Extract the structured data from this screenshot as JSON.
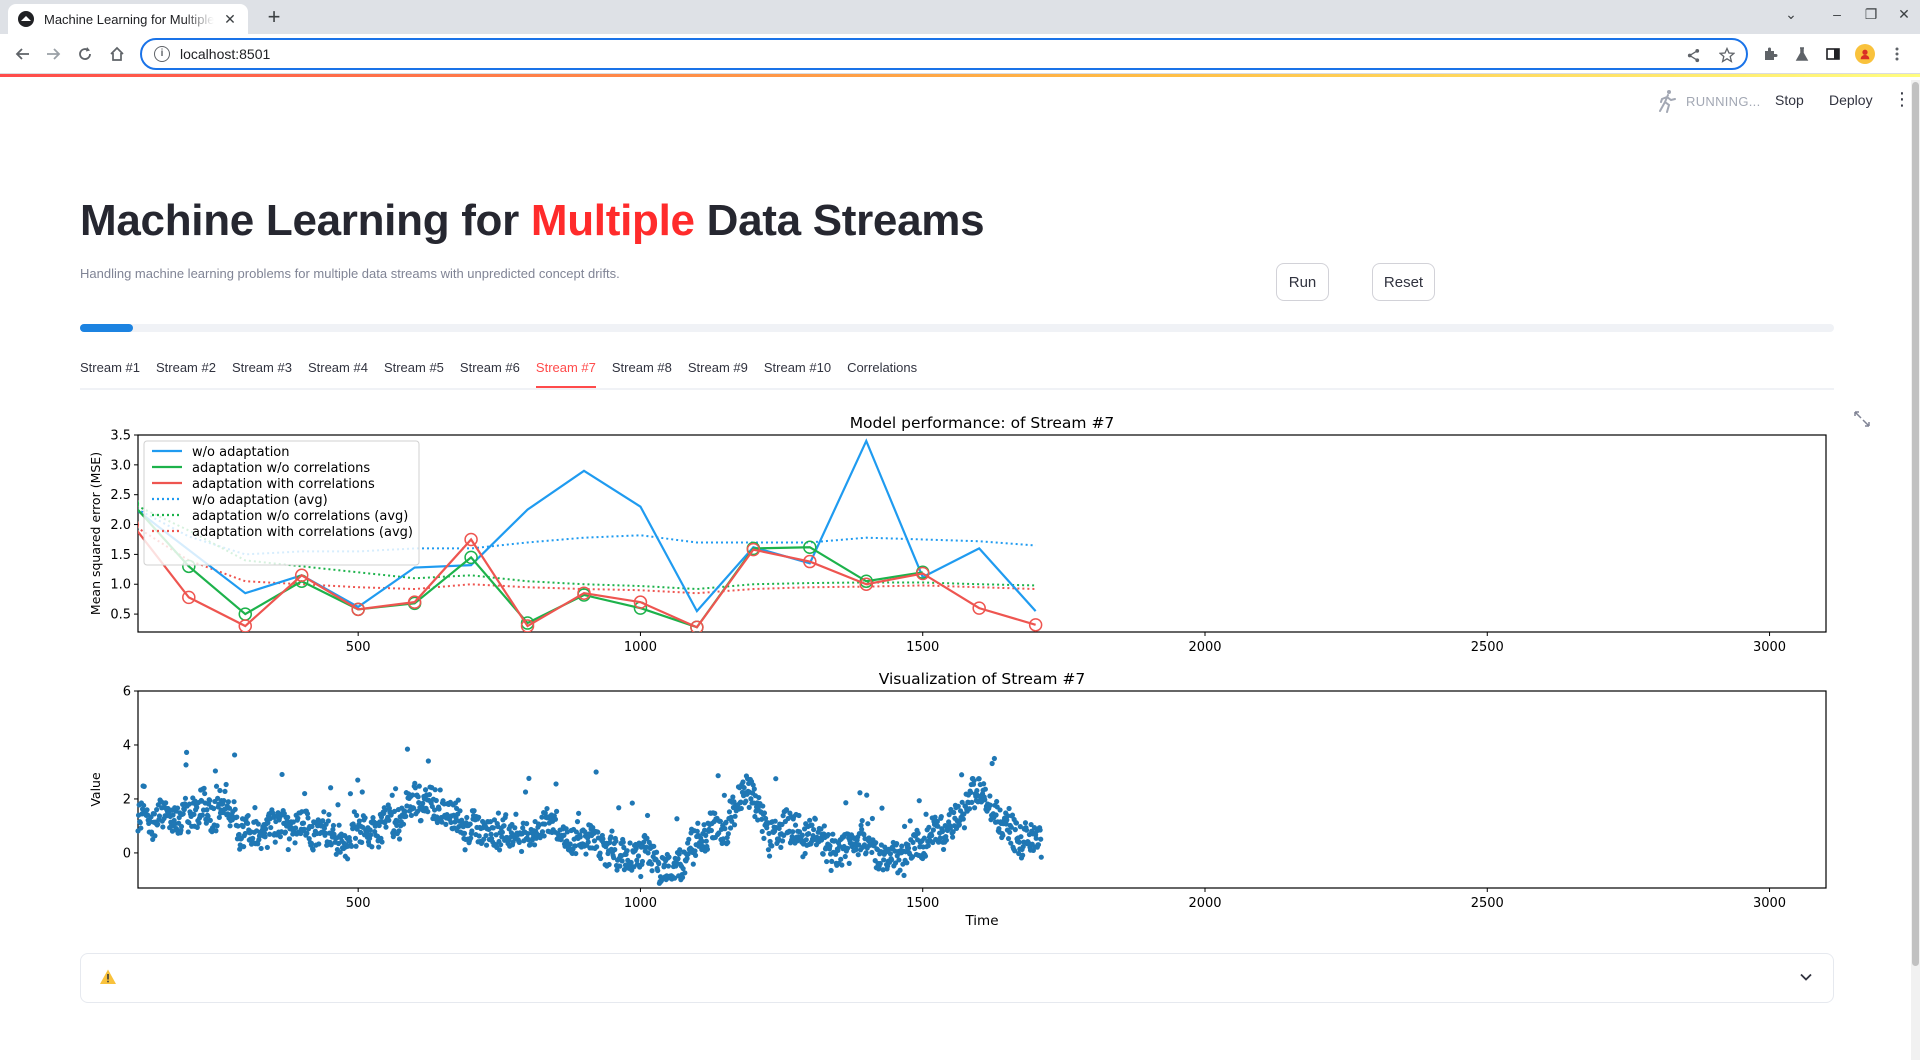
{
  "browser": {
    "tab_title": "Machine Learning for Multiple Data Streams",
    "url": "localhost:8501"
  },
  "header": {
    "status": "RUNNING...",
    "stop_label": "Stop",
    "deploy_label": "Deploy"
  },
  "page": {
    "title_part1": "Machine Learning for ",
    "title_accent": "Multiple",
    "title_part2": " Data Streams",
    "subtitle": "Handling machine learning problems for multiple data streams with unpredicted concept drifts.",
    "run_label": "Run",
    "reset_label": "Reset",
    "progress": 0.03,
    "accent_color": "#ff2b2b"
  },
  "tabs": [
    "Stream #1",
    "Stream #2",
    "Stream #3",
    "Stream #4",
    "Stream #5",
    "Stream #6",
    "Stream #7",
    "Stream #8",
    "Stream #9",
    "Stream #10",
    "Correlations"
  ],
  "active_tab": 6,
  "expander": {
    "icon": "warning-icon",
    "chevron": "chevron-down-icon"
  },
  "chart_data": [
    {
      "type": "line",
      "title": "Model performance: of Stream #7",
      "ylabel": "Mean squared error (MSE)",
      "xlabel": "",
      "xlim": [
        110,
        3100
      ],
      "ylim": [
        0.2,
        3.5
      ],
      "xticks": [
        500,
        1000,
        1500,
        2000,
        2500,
        3000
      ],
      "yticks": [
        0.5,
        1.0,
        1.5,
        2.0,
        2.5,
        3.0,
        3.5
      ],
      "ytick_labels": [
        "0.5",
        "1.0",
        "1.5",
        "2.0",
        "2.5",
        "3.0",
        "3.5"
      ],
      "legend_position": "upper-left",
      "series": [
        {
          "name": "w/o adaptation",
          "color": "#1f9bf0",
          "style": "solid",
          "markers": false,
          "x": [
            100,
            300,
            400,
            500,
            600,
            700,
            800,
            900,
            1000,
            1100,
            1200,
            1300,
            1400,
            1500,
            1600,
            1700
          ],
          "y": [
            2.3,
            0.85,
            1.15,
            0.62,
            1.28,
            1.32,
            2.25,
            2.9,
            2.3,
            0.55,
            1.62,
            1.35,
            3.4,
            1.12,
            1.6,
            0.55
          ]
        },
        {
          "name": "adaptation w/o correlations",
          "color": "#1db24b",
          "style": "solid",
          "markers": true,
          "x": [
            100,
            200,
            300,
            400,
            500,
            600,
            700,
            800,
            900,
            1000,
            1100,
            1200,
            1300,
            1400,
            1500
          ],
          "y": [
            2.35,
            1.3,
            0.5,
            1.05,
            0.58,
            0.68,
            1.45,
            0.35,
            0.82,
            0.6,
            0.28,
            1.6,
            1.62,
            1.05,
            1.2
          ]
        },
        {
          "name": "adaptation with correlations",
          "color": "#ee5550",
          "style": "solid",
          "markers": true,
          "x": [
            100,
            200,
            300,
            400,
            500,
            600,
            700,
            800,
            900,
            1000,
            1100,
            1200,
            1300,
            1400,
            1500,
            1600,
            1700
          ],
          "y": [
            2.0,
            0.78,
            0.3,
            1.15,
            0.58,
            0.7,
            1.75,
            0.3,
            0.85,
            0.7,
            0.28,
            1.58,
            1.38,
            1.0,
            1.18,
            0.6,
            0.32
          ]
        },
        {
          "name": "w/o adaptation (avg)",
          "color": "#1f9bf0",
          "style": "dotted",
          "markers": false,
          "x": [
            100,
            200,
            300,
            400,
            500,
            600,
            700,
            800,
            900,
            1000,
            1100,
            1200,
            1300,
            1400,
            1500,
            1600,
            1700
          ],
          "y": [
            2.3,
            1.8,
            1.5,
            1.55,
            1.55,
            1.6,
            1.6,
            1.7,
            1.78,
            1.82,
            1.7,
            1.7,
            1.7,
            1.78,
            1.75,
            1.72,
            1.65
          ]
        },
        {
          "name": "adaptation w/o correlations (avg)",
          "color": "#1db24b",
          "style": "dotted",
          "markers": false,
          "x": [
            100,
            200,
            300,
            400,
            500,
            600,
            700,
            800,
            900,
            1000,
            1100,
            1200,
            1300,
            1400,
            1500,
            1600,
            1700
          ],
          "y": [
            2.35,
            1.9,
            1.4,
            1.3,
            1.2,
            1.1,
            1.15,
            1.05,
            1.0,
            0.97,
            0.92,
            1.0,
            1.02,
            1.03,
            1.03,
            1.0,
            0.98
          ]
        },
        {
          "name": "adaptation with correlations (avg)",
          "color": "#ee5550",
          "style": "dotted",
          "markers": false,
          "x": [
            100,
            200,
            300,
            400,
            500,
            600,
            700,
            800,
            900,
            1000,
            1100,
            1200,
            1300,
            1400,
            1500,
            1600,
            1700
          ],
          "y": [
            2.0,
            1.4,
            1.05,
            1.0,
            0.95,
            0.92,
            1.0,
            0.95,
            0.92,
            0.9,
            0.85,
            0.92,
            0.95,
            0.96,
            0.98,
            0.95,
            0.92
          ]
        }
      ]
    },
    {
      "type": "scatter",
      "title": "Visualization of Stream #7",
      "xlabel": "Time",
      "ylabel": "Value",
      "xlim": [
        110,
        3100
      ],
      "ylim": [
        -1.3,
        6.0
      ],
      "xticks": [
        500,
        1000,
        1500,
        2000,
        2500,
        3000
      ],
      "yticks": [
        0,
        2,
        4,
        6
      ],
      "color": "#1f77b4",
      "n_points": 1600,
      "x_range": [
        110,
        1710
      ],
      "level_profile": [
        [
          110,
          1.0
        ],
        [
          200,
          1.6
        ],
        [
          260,
          1.4
        ],
        [
          300,
          1.0
        ],
        [
          400,
          0.9
        ],
        [
          450,
          0.4
        ],
        [
          500,
          0.7
        ],
        [
          560,
          1.1
        ],
        [
          600,
          1.8
        ],
        [
          650,
          1.4
        ],
        [
          700,
          1.0
        ],
        [
          760,
          0.9
        ],
        [
          800,
          0.7
        ],
        [
          850,
          0.9
        ],
        [
          900,
          0.6
        ],
        [
          950,
          0.2
        ],
        [
          1000,
          -0.2
        ],
        [
          1050,
          -0.5
        ],
        [
          1100,
          0.3
        ],
        [
          1150,
          0.9
        ],
        [
          1190,
          2.8
        ],
        [
          1220,
          1.0
        ],
        [
          1260,
          1.3
        ],
        [
          1300,
          0.6
        ],
        [
          1350,
          0.2
        ],
        [
          1400,
          0.2
        ],
        [
          1450,
          0.0
        ],
        [
          1500,
          0.3
        ],
        [
          1550,
          0.8
        ],
        [
          1590,
          2.6
        ],
        [
          1620,
          1.6
        ],
        [
          1660,
          0.6
        ],
        [
          1710,
          0.6
        ]
      ]
    }
  ]
}
